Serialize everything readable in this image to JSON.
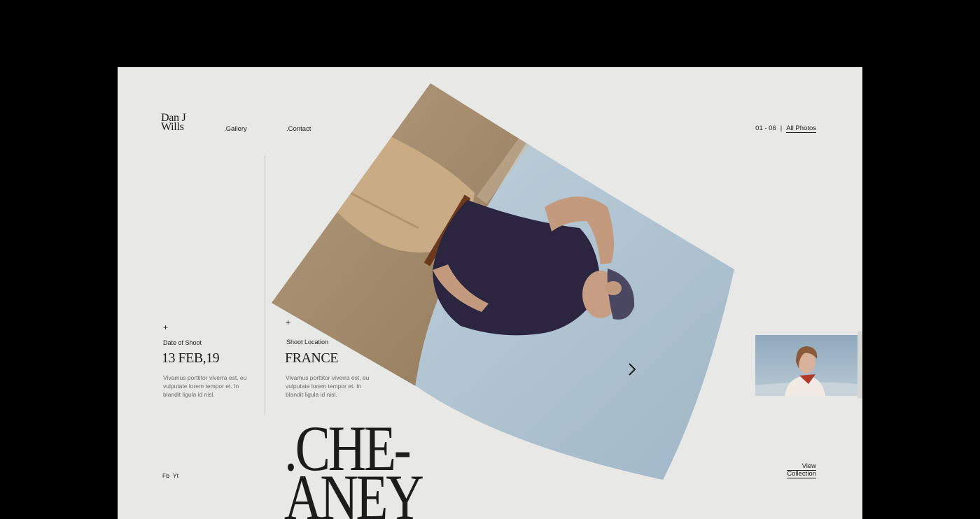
{
  "brand": {
    "line1": "Dan J",
    "line2": "Wills"
  },
  "nav": {
    "gallery": ".Gallery",
    "contact": ".Contact"
  },
  "counter": {
    "range": "01 - 06",
    "separator": "|",
    "all_photos": "All Photos"
  },
  "shoot": {
    "date_label": "Date of Shoot",
    "date_value": "13 FEB,19",
    "date_desc": "Vivamus porttitor viverra est, eu vulputate lorem tempor et. In blandit ligula id nisl.",
    "location_label": "Shoot Location",
    "location_value": "FRANCE",
    "location_desc": "Vivamus porttitor viverra est, eu vulputate lorem tempor et. In blandit ligula id nisl."
  },
  "plus_symbol": "+",
  "title": {
    "line1": ".CHE-",
    "line2": "ANEY"
  },
  "social": {
    "fb": "Fb",
    "yt": "Yt"
  },
  "view_collection": {
    "line1": "View",
    "line2": "Collection"
  },
  "icons": {
    "next": "chevron-right-icon"
  },
  "colors": {
    "background": "#e8e8e7",
    "text": "#1c1c1c",
    "frame": "#000000"
  }
}
